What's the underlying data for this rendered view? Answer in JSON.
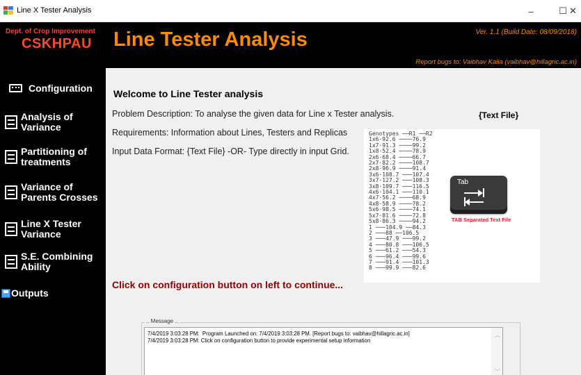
{
  "window": {
    "title": "Line X Tester Analysis",
    "minimize": "–",
    "maximize": "☐",
    "close": "✕"
  },
  "header": {
    "dept": "Dept. of Crop Improvement",
    "org": "CSKHPAU",
    "app_title": "Line Tester Analysis",
    "version": "Ver. 1.1 (Build Date: 08/09/2018)",
    "report": "Report bugs to: Vaibhav Kalia (vaibhav@hillagric.ac.in)"
  },
  "sidebar": {
    "items": [
      {
        "label": "Configuration",
        "icon": "keyboard-icon"
      },
      {
        "label": "Analysis of Variance",
        "icon": "document-icon"
      },
      {
        "label": "Partitioning of treatments",
        "icon": "document-icon"
      },
      {
        "label": "Variance of Parents Crosses",
        "icon": "document-icon"
      },
      {
        "label": "Line X Tester Variance",
        "icon": "document-icon"
      },
      {
        "label": "S.E. Combining Ability",
        "icon": "document-icon"
      },
      {
        "label": "Outputs",
        "icon": "save-icon"
      }
    ]
  },
  "main": {
    "welcome": "Welcome to Line Tester analysis",
    "problem": "Problem Description: To analyse the given data for Line x Tester analysis.",
    "requirements": "Requirements: Information about Lines, Testers and Replicas",
    "input_format": "Input Data Format: {Text File} -OR- Type directly in input Grid.",
    "text_file_label": "{Text File}",
    "sample_data": "Genotypes ──R1 ──R2\n1x6·92.6 ────76.9\n1x7·91.3 ────99.2\n1x8·52.4 ────78.9\n2x6·68.4 ────66.7\n2x7·82.2 ────108.7\n2x8·96.9 ────91.4\n3x6·108.7 ───107.4\n3x7·127.2 ───108.3\n3x8·109.7 ───116.5\n4x6·104.1 ───110.1\n4x7·56.2 ────68.9\n4x8·58.9 ────78.2\n5x6·98.5 ────74.1\n5x7·81.6 ────72.8\n5x8·86.3 ────94.2\n1 ───104.9 ──84.3\n2 ───88 ──106.5\n3 ───47.9 ───99.2\n4 ───80.8 ───106.5\n5 ───61.2 ───54.3\n6 ───96.4 ───99.6\n7 ───91.4 ───101.3\n8 ───99.9 ───82.6",
    "tab_key_label": "Tab",
    "tab_caption": "TAB Separated Text File",
    "cta": "Click on configuration button on left to continue..."
  },
  "message": {
    "legend": ".. Message ..",
    "lines": "7/4/2019 3:03:28 PM:  Program Launched on: 7/4/2019 3:03:28 PM. [Report bugs to: vaibhav@hillagric.ac.in]\n7/4/2019 3:03:28 PM: Click on configuration button to provide experimental setup information",
    "scroll_up": "︿",
    "scroll_down": "﹀"
  },
  "colors": {
    "accent_orange": "#ff8c00",
    "org_red": "#ff4a2a",
    "cta_red": "#8b0000",
    "sidebar_bg": "#000000",
    "content_bg": "#f0f0f0"
  }
}
